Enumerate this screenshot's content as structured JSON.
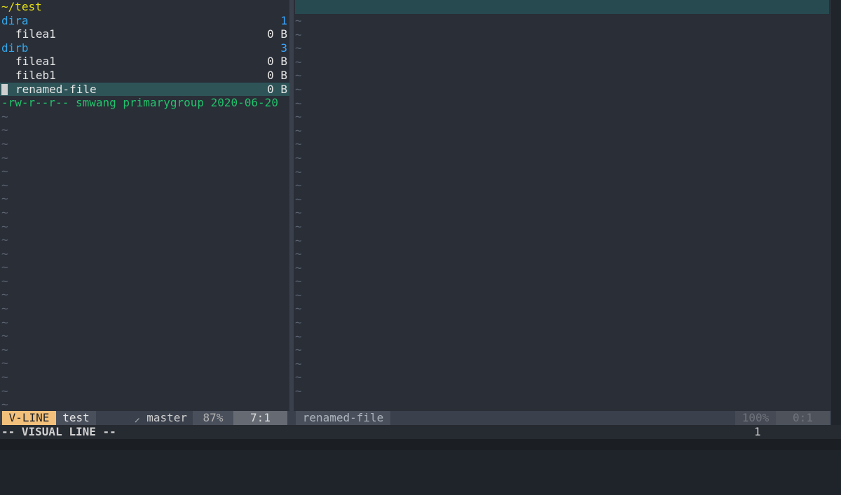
{
  "left_pane": {
    "path": "~/test",
    "entries": [
      {
        "name": "dira",
        "count": "1"
      },
      {
        "name": "filea1",
        "size": "0 B"
      },
      {
        "name": "dirb",
        "count": "3"
      },
      {
        "name": "filea1",
        "size": "0 B"
      },
      {
        "name": "fileb1",
        "size": "0 B"
      },
      {
        "name": "renamed-file",
        "size": "0 B"
      }
    ],
    "file_info": "-rw-r--r-- smwang primarygroup 2020-06-20",
    "tilde": "~"
  },
  "status_left": {
    "mode": "V-LINE",
    "filename": "test",
    "branch": "⸝ master",
    "percent": "87%",
    "position": "7:1"
  },
  "status_right": {
    "filename": "renamed-file",
    "percent": "100%",
    "position": "0:1"
  },
  "cmdline": {
    "text": "-- VISUAL LINE --",
    "count": "1"
  },
  "colors": {
    "background": "#292e37",
    "directory": "#34a6e8",
    "path": "#e5df15",
    "file_info": "#22c26b",
    "mode_badge": "#f2c07a",
    "selection": "#2e5458"
  }
}
